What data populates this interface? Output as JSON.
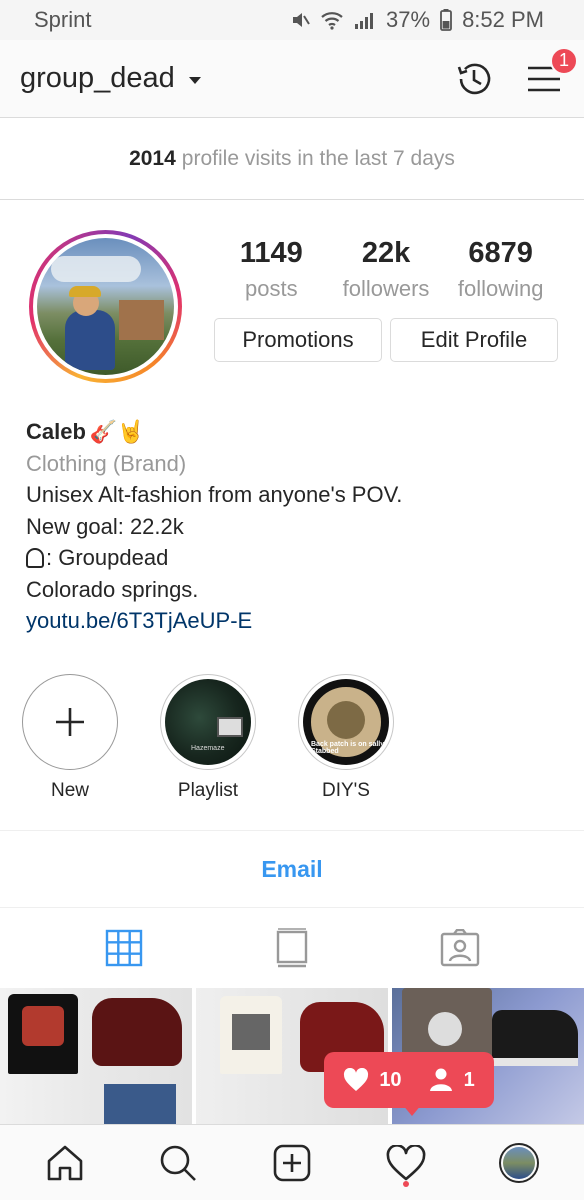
{
  "status_bar": {
    "carrier": "Sprint",
    "battery": "37%",
    "time": "8:52 PM"
  },
  "header": {
    "username": "group_dead",
    "notification_count": "1"
  },
  "profile_visits": {
    "count": "2014",
    "text": "profile visits in the last 7 days"
  },
  "stats": [
    {
      "value": "1149",
      "label": "posts"
    },
    {
      "value": "22k",
      "label": "followers"
    },
    {
      "value": "6879",
      "label": "following"
    }
  ],
  "buttons": {
    "promotions": "Promotions",
    "edit_profile": "Edit Profile"
  },
  "bio": {
    "name": "Caleb",
    "name_emojis": "🎸🤘",
    "category": "Clothing (Brand)",
    "line1": "Unisex Alt-fashion from anyone's POV.",
    "line2": "New goal: 22.2k",
    "line3": ": Groupdead",
    "line4": "Colorado springs.",
    "link": "youtu.be/6T3TjAeUP-E"
  },
  "highlights": [
    {
      "label": "New",
      "icon": "plus-icon"
    },
    {
      "label": "Playlist",
      "caption": "Hazemaze"
    },
    {
      "label": "DIY'S",
      "caption": "Back patch is on sally!! Stabbed"
    }
  ],
  "email_label": "Email",
  "tabs": [
    {
      "icon": "grid-icon",
      "active": true
    },
    {
      "icon": "feed-icon",
      "active": false
    },
    {
      "icon": "tagged-icon",
      "active": false
    }
  ],
  "activity": {
    "likes": "10",
    "follows": "1"
  },
  "colors": {
    "accent_blue": "#3897f0",
    "notification_red": "#ed4956",
    "link_blue": "#003569"
  },
  "bottom_nav": [
    {
      "icon": "home-icon"
    },
    {
      "icon": "search-icon"
    },
    {
      "icon": "add-post-icon"
    },
    {
      "icon": "heart-icon"
    },
    {
      "icon": "profile-avatar"
    }
  ]
}
